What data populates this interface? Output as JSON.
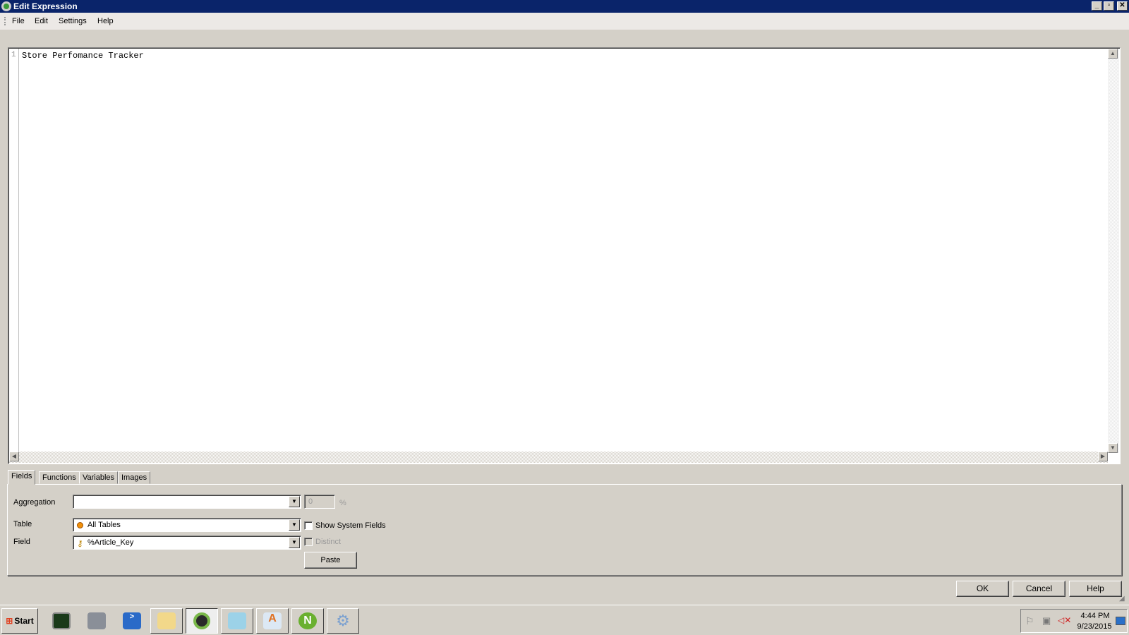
{
  "window": {
    "title": "Edit Expression"
  },
  "menu": [
    "File",
    "Edit",
    "Settings",
    "Help"
  ],
  "editor": {
    "line_number": "1",
    "text": "Store Perfomance Tracker"
  },
  "tabs": [
    "Fields",
    "Functions",
    "Variables",
    "Images"
  ],
  "active_tab": "Fields",
  "fields": {
    "aggregation_label": "Aggregation",
    "aggregation_value": "",
    "percent_value": "0",
    "percent_unit": "%",
    "table_label": "Table",
    "table_value": "All Tables",
    "field_label": "Field",
    "field_value": "%Article_Key",
    "show_system_fields": "Show System Fields",
    "show_system_fields_checked": false,
    "distinct": "Distinct",
    "distinct_checked": false,
    "paste": "Paste"
  },
  "buttons": {
    "ok": "OK",
    "cancel": "Cancel",
    "help": "Help"
  },
  "taskbar": {
    "start": "Start",
    "time": "4:44 PM",
    "date": "9/23/2015"
  },
  "colors": {
    "titlebar": "#0a246a",
    "face": "#d4d0c8"
  }
}
